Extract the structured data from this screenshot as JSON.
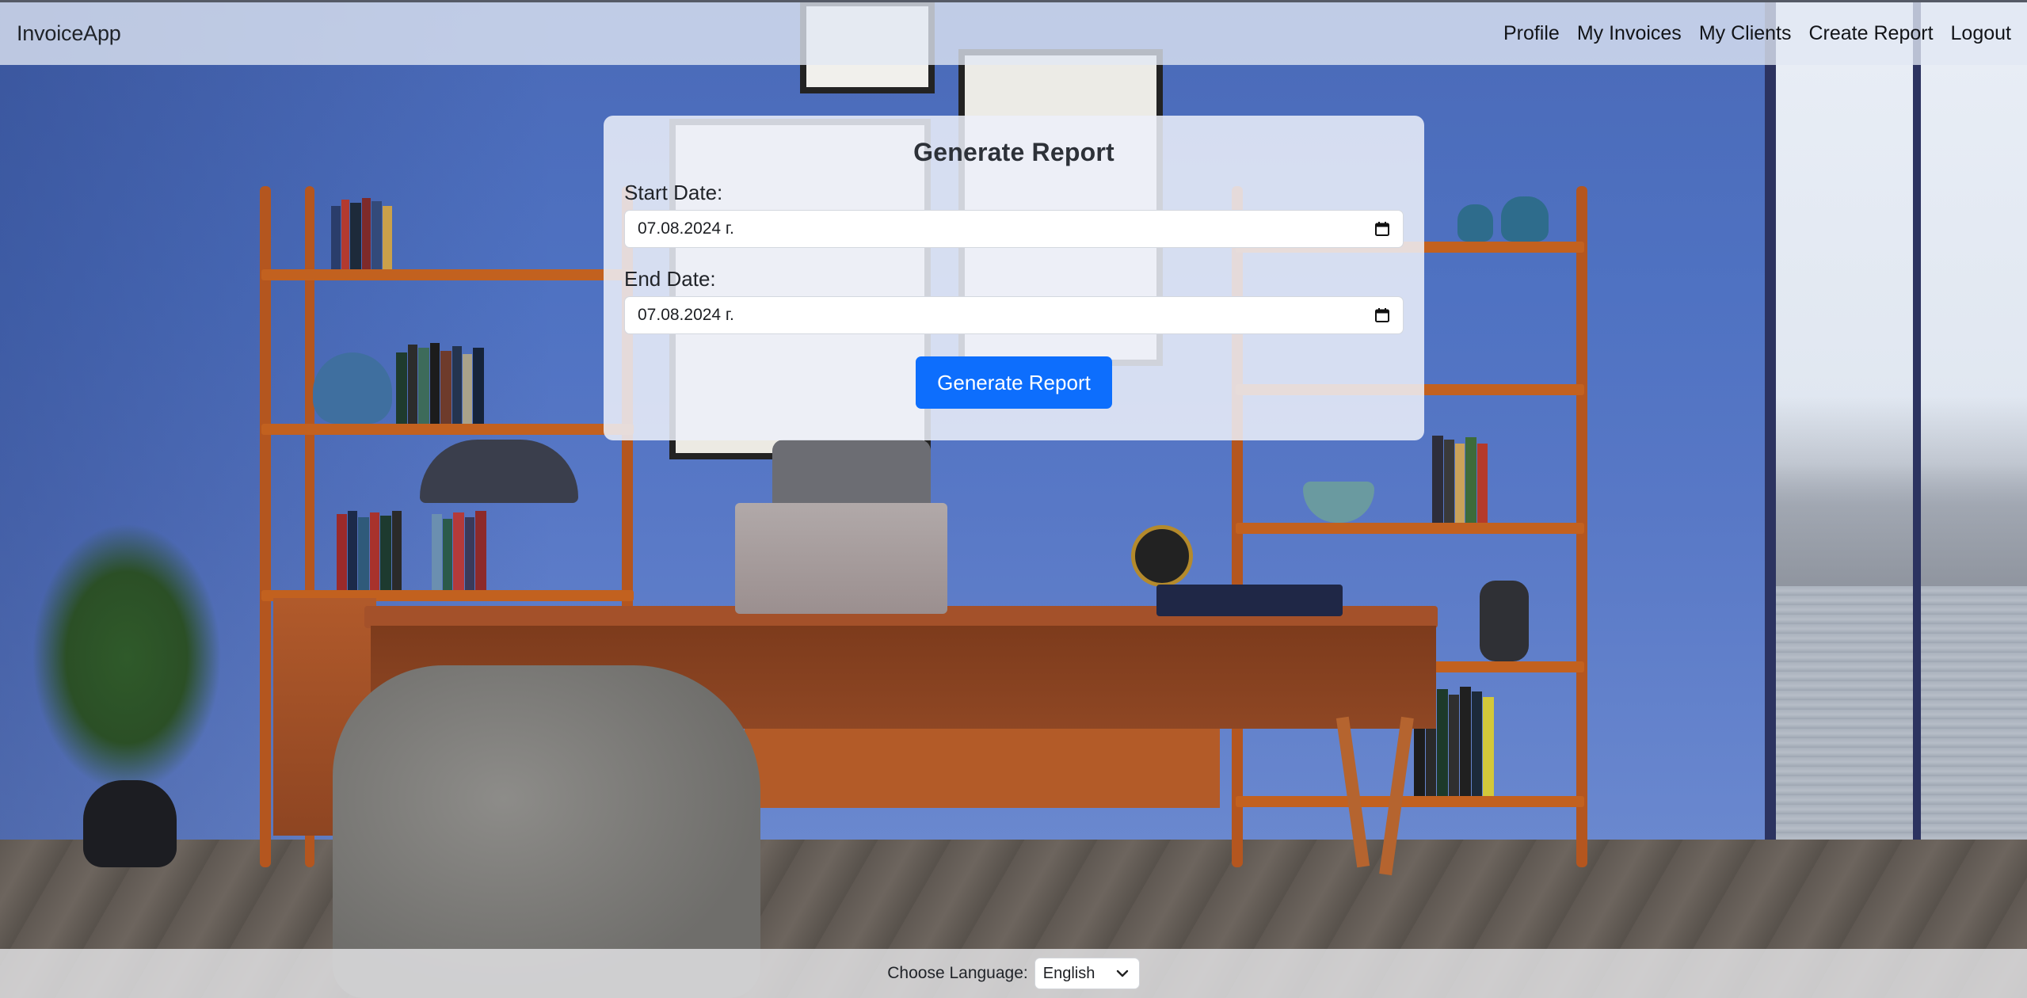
{
  "navbar": {
    "brand": "InvoiceApp",
    "links": [
      {
        "label": "Profile"
      },
      {
        "label": "My Invoices"
      },
      {
        "label": "My Clients"
      },
      {
        "label": "Create Report"
      },
      {
        "label": "Logout"
      }
    ]
  },
  "report_form": {
    "title": "Generate Report",
    "start_date": {
      "label": "Start Date:",
      "value": "07.08.2024 г."
    },
    "end_date": {
      "label": "End Date:",
      "value": "07.08.2024 г."
    },
    "submit_label": "Generate Report"
  },
  "footer": {
    "language_label": "Choose Language:",
    "language_selected": "English"
  },
  "icons": {
    "date_picker": "calendar-icon",
    "select_arrow": "chevron-down-icon"
  },
  "colors": {
    "primary_button": "#0d6efd",
    "navbar_bg": "#e2e8f4",
    "card_bg": "#ecf0f9"
  }
}
